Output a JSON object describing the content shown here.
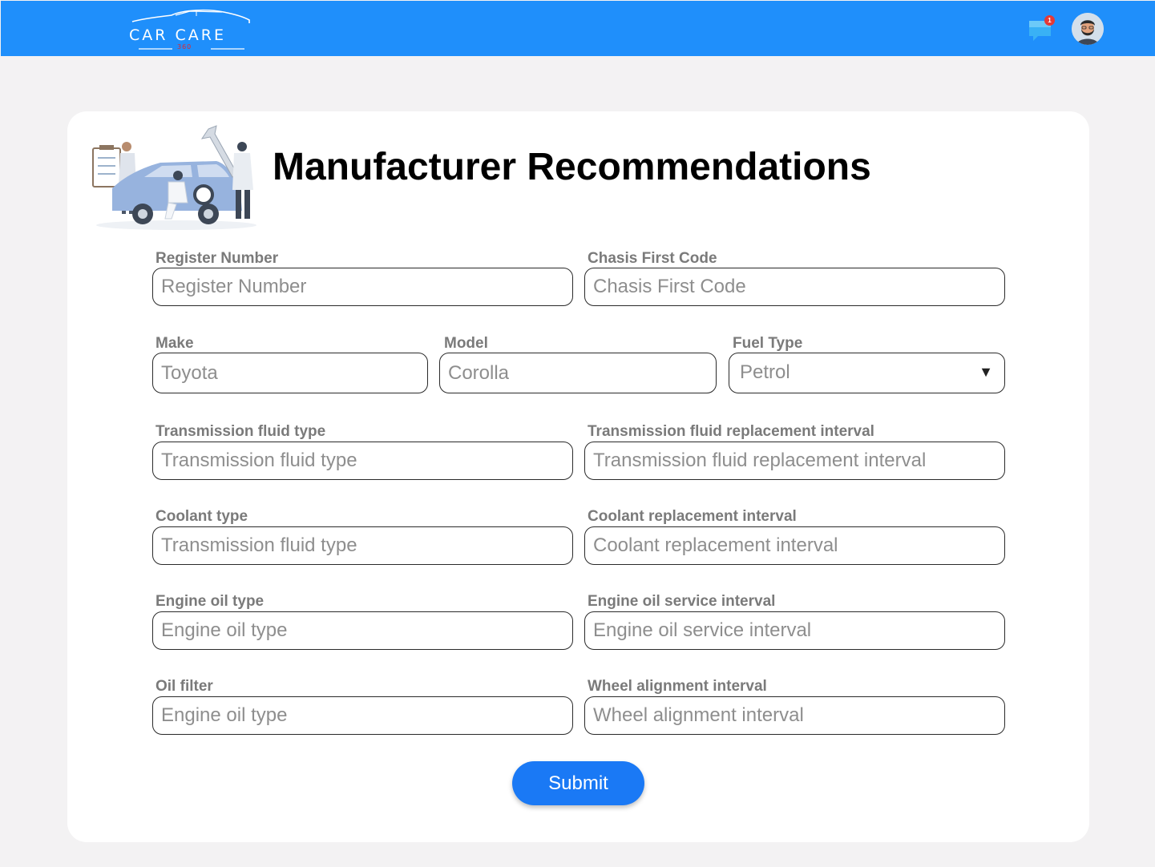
{
  "header": {
    "logo_text": "CAR CARE",
    "logo_sub": "360",
    "notification_count": "1",
    "brand_color": "#1f8ffb"
  },
  "page": {
    "title": "Manufacturer Recommendations"
  },
  "form": {
    "register_number": {
      "label": "Register Number",
      "placeholder": "Register Number"
    },
    "chasis_first_code": {
      "label": "Chasis First Code",
      "placeholder": "Chasis First Code"
    },
    "make": {
      "label": "Make",
      "value": "Toyota"
    },
    "model": {
      "label": "Model",
      "value": "Corolla"
    },
    "fuel_type": {
      "label": "Fuel Type",
      "value": "Petrol",
      "caret": "▼"
    },
    "transmission_fluid_type": {
      "label": "Transmission fluid type",
      "placeholder": "Transmission fluid type"
    },
    "transmission_fluid_interval": {
      "label": "Transmission fluid replacement interval",
      "placeholder": "Transmission fluid replacement interval"
    },
    "coolant_type": {
      "label": "Coolant type",
      "placeholder": "Transmission fluid type"
    },
    "coolant_interval": {
      "label": "Coolant replacement interval",
      "placeholder": "Coolant replacement interval"
    },
    "engine_oil_type": {
      "label": "Engine oil type",
      "placeholder": "Engine oil type"
    },
    "engine_oil_interval": {
      "label": "Engine oil service interval",
      "placeholder": "Engine oil service interval"
    },
    "oil_filter": {
      "label": "Oil filter",
      "placeholder": "Engine oil type"
    },
    "wheel_alignment_interval": {
      "label": "Wheel alignment interval",
      "placeholder": "Wheel alignment interval"
    },
    "submit_label": "Submit",
    "accent_color": "#1a79f5"
  }
}
